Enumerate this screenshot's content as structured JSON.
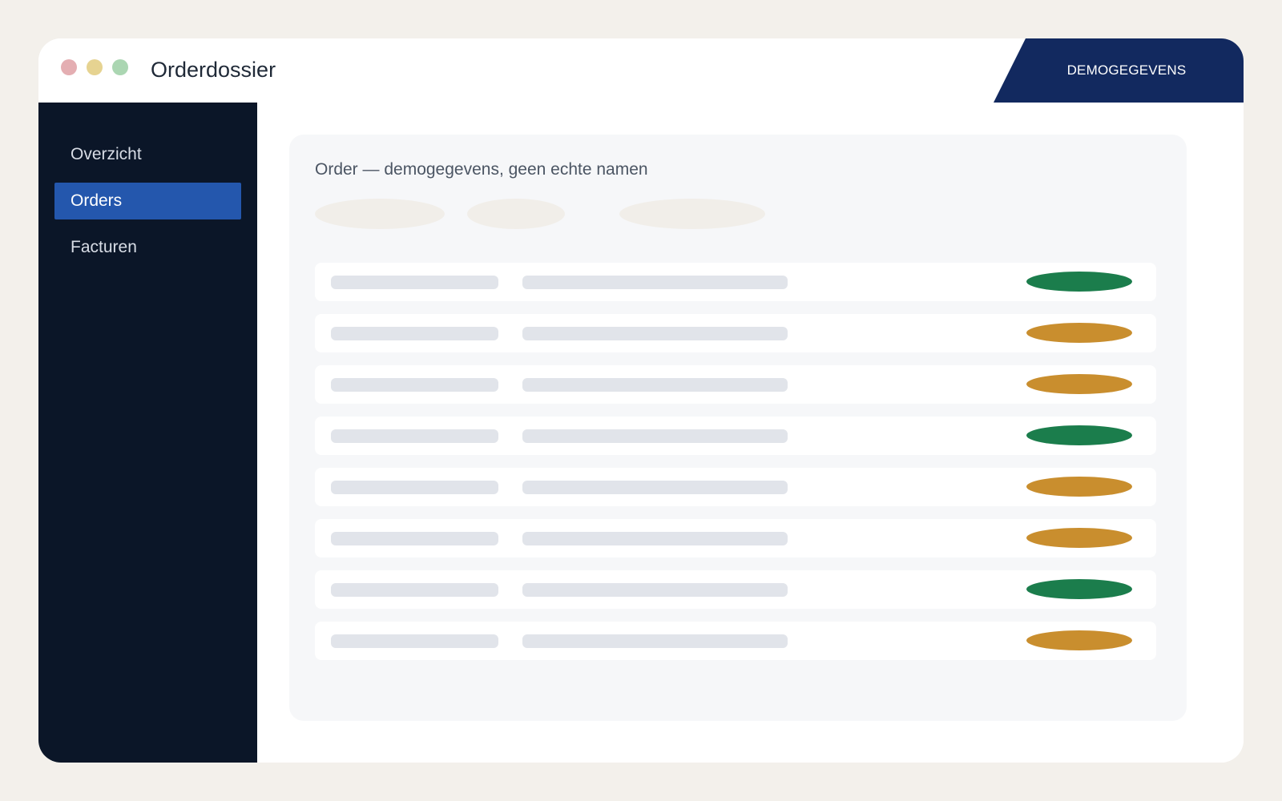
{
  "window": {
    "title": "Orderdossier",
    "controls": [
      "close-icon",
      "minimize-icon",
      "maximize-icon"
    ]
  },
  "banner": {
    "label": "DEMOGEGEVENS",
    "background_color": "#12295f"
  },
  "sidebar": {
    "items": [
      {
        "label": "Overzicht",
        "active": false
      },
      {
        "label": "Orders",
        "active": true
      },
      {
        "label": "Facturen",
        "active": false
      }
    ]
  },
  "main": {
    "card_title": "Order — demogegevens, geen echte namen",
    "filters": [
      "placeholder",
      "placeholder",
      "placeholder"
    ],
    "rows": [
      {
        "status_color": "#1b7d4c"
      },
      {
        "status_color": "#c98e2e"
      },
      {
        "status_color": "#c98e2e"
      },
      {
        "status_color": "#1b7d4c"
      },
      {
        "status_color": "#c98e2e"
      },
      {
        "status_color": "#c98e2e"
      },
      {
        "status_color": "#1b7d4c"
      },
      {
        "status_color": "#c98e2e"
      }
    ]
  },
  "colors": {
    "page_background": "#f3f0eb",
    "sidebar_background": "#0b1628",
    "active_nav_background": "#2457ad",
    "status_green": "#1b7d4c",
    "status_amber": "#c98e2e",
    "placeholder": "#e1e4ea"
  }
}
